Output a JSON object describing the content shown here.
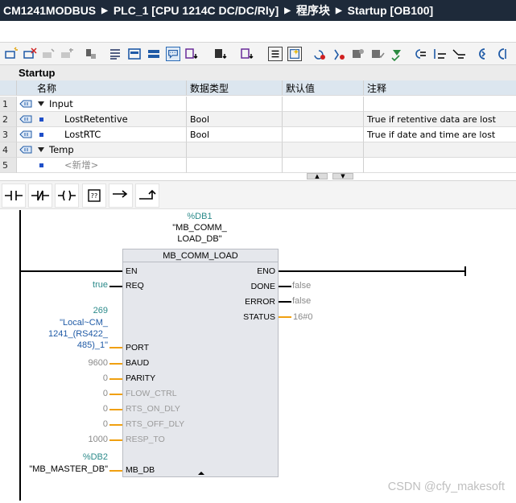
{
  "titlebar": {
    "crumbs": [
      "CM1241MODBUS",
      "PLC_1 [CPU 1214C DC/DC/Rly]",
      "程序块",
      "Startup [OB100]"
    ],
    "separator": "▶"
  },
  "interface": {
    "block_name": "Startup",
    "headers": {
      "name": "名称",
      "datatype": "数据类型",
      "default": "默认值",
      "comment": "注释"
    },
    "rows": [
      {
        "num": "1",
        "kind": "section",
        "name": "Input",
        "datatype": "",
        "default": "",
        "comment": ""
      },
      {
        "num": "2",
        "kind": "var",
        "name": "LostRetentive",
        "datatype": "Bool",
        "default": "",
        "comment": "True if retentive data are lost"
      },
      {
        "num": "3",
        "kind": "var",
        "name": "LostRTC",
        "datatype": "Bool",
        "default": "",
        "comment": "True if date and time are lost"
      },
      {
        "num": "4",
        "kind": "section",
        "name": "Temp",
        "datatype": "",
        "default": "",
        "comment": ""
      },
      {
        "num": "5",
        "kind": "add",
        "name": "<新增>",
        "datatype": "",
        "default": "",
        "comment": ""
      }
    ]
  },
  "ladder_toolbar": {
    "items": [
      "normally-open-contact",
      "normally-closed-contact",
      "output-coil",
      "empty-box",
      "open-branch",
      "close-branch"
    ]
  },
  "network": {
    "instance_db": {
      "number": "%DB1",
      "name_line1": "\"MB_COMM_",
      "name_line2": "LOAD_DB\""
    },
    "block": {
      "title": "MB_COMM_LOAD",
      "inputs": [
        {
          "pin": "EN",
          "actual": "",
          "dim": false
        },
        {
          "pin": "REQ",
          "actual": "true",
          "dim": false
        },
        {
          "pin": "PORT",
          "actual_lines": [
            "269",
            "\"Local~CM_",
            "1241_(RS422_",
            "485)_1\""
          ],
          "dim": false
        },
        {
          "pin": "BAUD",
          "actual": "9600",
          "dim": false
        },
        {
          "pin": "PARITY",
          "actual": "0",
          "dim": false
        },
        {
          "pin": "FLOW_CTRL",
          "actual": "0",
          "dim": true
        },
        {
          "pin": "RTS_ON_DLY",
          "actual": "0",
          "dim": true
        },
        {
          "pin": "RTS_OFF_DLY",
          "actual": "0",
          "dim": true
        },
        {
          "pin": "RESP_TO",
          "actual": "1000",
          "dim": true
        },
        {
          "pin": "MB_DB",
          "actual_lines": [
            "%DB2",
            "\"MB_MASTER_DB\""
          ],
          "dim": false
        }
      ],
      "outputs": [
        {
          "pin": "ENO",
          "actual": ""
        },
        {
          "pin": "DONE",
          "actual": "false"
        },
        {
          "pin": "ERROR",
          "actual": "false"
        },
        {
          "pin": "STATUS",
          "actual": "16#0"
        }
      ]
    }
  },
  "watermark": "CSDN @cfy_makesoft",
  "colors": {
    "titlebar_bg": "#1e2a3a",
    "header_bg": "#dce6ef",
    "block_bg": "#e5e7ec",
    "pin_wire": "#f0a010",
    "actual_teal": "#2b8a8a",
    "actual_blue": "#1f5aa6"
  }
}
